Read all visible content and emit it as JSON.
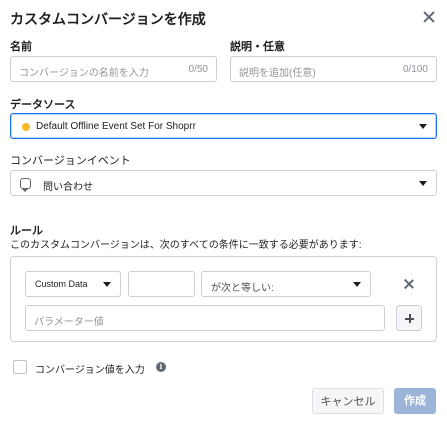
{
  "dialog": {
    "title": "カスタムコンバージョンを作成"
  },
  "name_field": {
    "label": "名前",
    "placeholder": "コンバージョンの名前を入力",
    "counter": "0/50"
  },
  "description_field": {
    "label": "説明・任意",
    "placeholder": "説明を追加(任意)",
    "counter": "0/100"
  },
  "data_source": {
    "label": "データソース",
    "selected": "Default Offline Event Set For Shoprr",
    "status_color": "#f7b928"
  },
  "conversion_event": {
    "label": "コンバージョンイベント",
    "selected": "問い合わせ",
    "icon": "chat-bubble-icon"
  },
  "rules": {
    "title": "ルール",
    "description": "このカスタムコンバージョンは、次のすべての条件に一致する必要があります:",
    "condition": {
      "field_select": "Custom Data",
      "operator_select": "が次と等しい:",
      "value_placeholder": "パラメーター値"
    }
  },
  "conversion_value": {
    "checkbox_label": "コンバージョン値を入力",
    "info_icon": "i"
  },
  "footer": {
    "cancel_label": "キャンセル",
    "create_label": "作成"
  },
  "colors": {
    "accent": "#1877f2",
    "create_disabled": "#9cb4d8"
  }
}
